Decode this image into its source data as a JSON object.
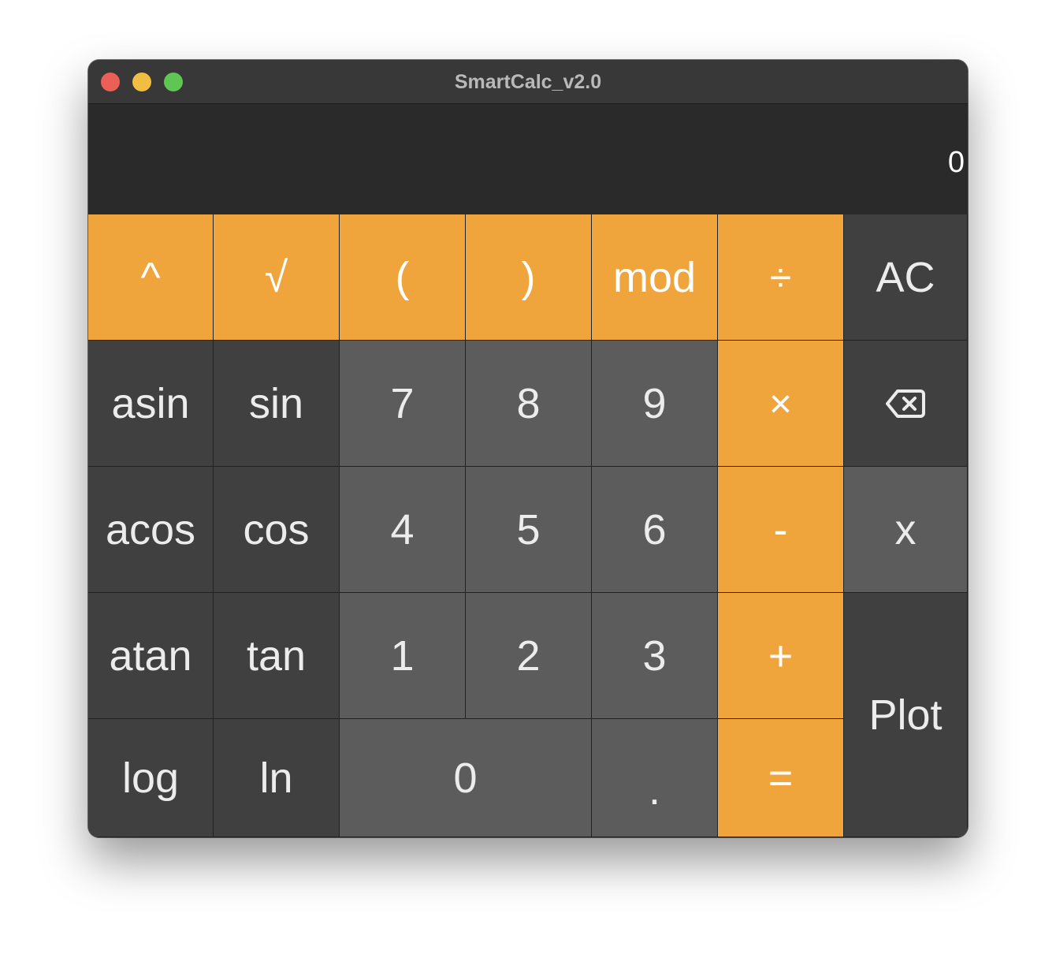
{
  "window": {
    "title": "SmartCalc_v2.0"
  },
  "display": {
    "value": "0"
  },
  "keys": {
    "pow": "^",
    "sqrt": "√",
    "lparen": "(",
    "rparen": ")",
    "mod": "mod",
    "div": "÷",
    "ac": "AC",
    "asin": "asin",
    "sin": "sin",
    "seven": "7",
    "eight": "8",
    "nine": "9",
    "mul": "×",
    "backspace_icon": "backspace-icon",
    "acos": "acos",
    "cos": "cos",
    "four": "4",
    "five": "5",
    "six": "6",
    "minus": "-",
    "x": "x",
    "atan": "atan",
    "tan": "tan",
    "one": "1",
    "two": "2",
    "three": "3",
    "plus": "+",
    "plot": "Plot",
    "log": "log",
    "ln": "ln",
    "zero": "0",
    "dot": ".",
    "equals": "="
  },
  "colors": {
    "accent": "#f0a43c",
    "function_key": "#404040",
    "digit_key": "#5c5c5c",
    "display_bg": "#2a2a2a",
    "titlebar": "#383838"
  }
}
